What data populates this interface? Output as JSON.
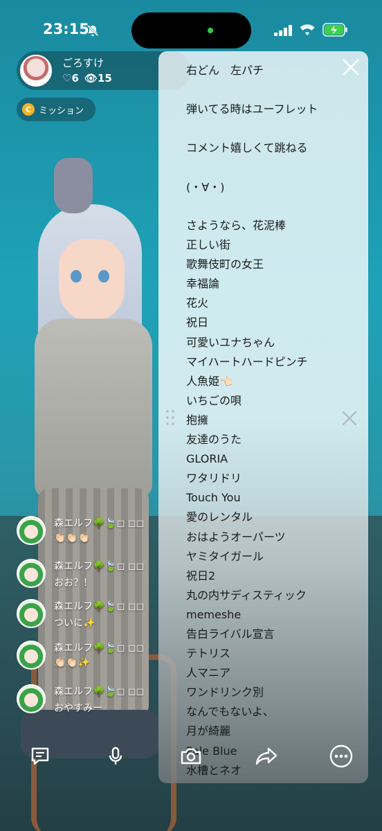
{
  "status_bar": {
    "time": "23:15",
    "icons": [
      "mute-bell-icon",
      "signal-icon",
      "wifi-icon",
      "battery-charging-icon"
    ]
  },
  "streamer": {
    "name": "ごろすけ",
    "followers": "♡6",
    "viewers": "👁15"
  },
  "mission": {
    "label": "ミッション",
    "coin_letter": "C"
  },
  "chat": [
    {
      "name": "森エルフ🌳🍃◻ ◻◻",
      "message": "👏🏻👏🏻👏🏻"
    },
    {
      "name": "森エルフ🌳🍃◻ ◻◻",
      "message": "おお？！"
    },
    {
      "name": "森エルフ🌳🍃◻ ◻◻",
      "message": "ついに✨"
    },
    {
      "name": "森エルフ🌳🍃◻ ◻◻",
      "message": "👏🏻👏🏻✨"
    },
    {
      "name": "森エルフ🌳🍃◻ ◻◻",
      "message": "おやすみー"
    }
  ],
  "setlist": {
    "notes": [
      "右どん　左パチ",
      "弾いてる時はユーフレット",
      "コメント嬉しくて跳ねる",
      "(・∀・)"
    ],
    "songs": [
      "さようなら、花泥棒",
      "正しい街",
      "歌舞伎町の女王",
      "幸福論",
      "花火",
      "祝日",
      "可愛いユナちゃん",
      "マイハートハードピンチ",
      "人魚姫👈🏻",
      "いちごの唄",
      "抱擁",
      "友達のうた",
      "GLORIA",
      "ワタリドリ",
      "Touch You",
      "愛のレンタル",
      "おはようオーパーツ",
      "ヤミタイガール",
      "祝日2",
      "丸の内サディスティック",
      "memeshe",
      "告白ライバル宣言",
      "テトリス",
      "人マニア",
      "ワンドリンク別",
      "なんでもないよ、",
      "月が綺麗",
      "Pale Blue",
      "水槽とネオ"
    ]
  },
  "colors": {
    "accent_green": "#2ecc40",
    "coin": "#f0b429",
    "panel_text": "#1a1a1a"
  }
}
